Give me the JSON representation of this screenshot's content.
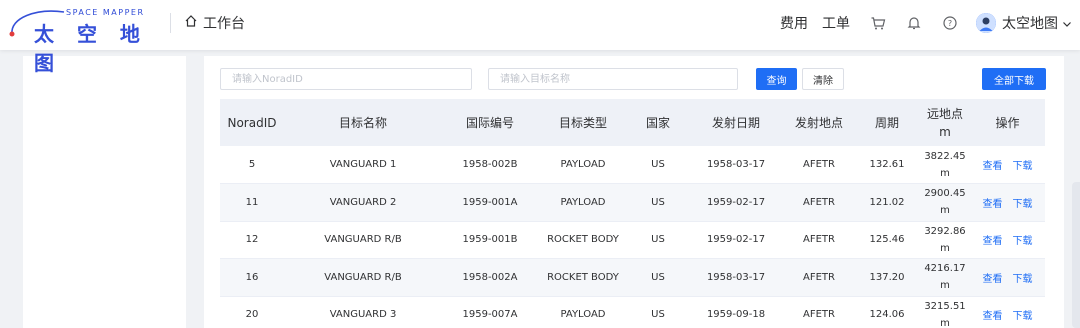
{
  "header": {
    "logo_sub": "SPACE MAPPER",
    "logo_main": "太 空 地 图",
    "workspace_label": "工作台",
    "links": [
      "费用",
      "工单"
    ],
    "user_name": "太空地图"
  },
  "search": {
    "norad_placeholder": "请输入NoradID",
    "name_placeholder": "请输入目标名称",
    "query_label": "查询",
    "clear_label": "清除",
    "download_all_label": "全部下载"
  },
  "table": {
    "columns": [
      "NoradID",
      "目标名称",
      "国际编号",
      "目标类型",
      "国家",
      "发射日期",
      "发射地点",
      "周期",
      "远地点\nm",
      "操作"
    ],
    "col_apogee_line1": "远地点",
    "col_apogee_line2": "m",
    "rows": [
      {
        "norad": "5",
        "name": "VANGUARD 1",
        "intl": "1958-002B",
        "type": "PAYLOAD",
        "country": "US",
        "date": "1958-03-17",
        "site": "AFETR",
        "period": "132.61",
        "apogee": "3822.45",
        "apogee_unit": "m"
      },
      {
        "norad": "11",
        "name": "VANGUARD 2",
        "intl": "1959-001A",
        "type": "PAYLOAD",
        "country": "US",
        "date": "1959-02-17",
        "site": "AFETR",
        "period": "121.02",
        "apogee": "2900.45",
        "apogee_unit": "m"
      },
      {
        "norad": "12",
        "name": "VANGUARD R/B",
        "intl": "1959-001B",
        "type": "ROCKET BODY",
        "country": "US",
        "date": "1959-02-17",
        "site": "AFETR",
        "period": "125.46",
        "apogee": "3292.86",
        "apogee_unit": "m"
      },
      {
        "norad": "16",
        "name": "VANGUARD R/B",
        "intl": "1958-002A",
        "type": "ROCKET BODY",
        "country": "US",
        "date": "1958-03-17",
        "site": "AFETR",
        "period": "137.20",
        "apogee": "4216.17",
        "apogee_unit": "m"
      },
      {
        "norad": "20",
        "name": "VANGUARD 3",
        "intl": "1959-007A",
        "type": "PAYLOAD",
        "country": "US",
        "date": "1959-09-18",
        "site": "AFETR",
        "period": "124.06",
        "apogee": "3215.51",
        "apogee_unit": "m"
      }
    ],
    "view_label": "查看",
    "download_label": "下载"
  },
  "colors": {
    "primary": "#1f6ef5",
    "brand": "#3550d8",
    "header_bg": "#ffffff",
    "page_bg": "#f0f2f5",
    "table_head_bg": "#eef1f7",
    "stripe_bg": "#f5f7fa"
  },
  "icons": [
    "home-icon",
    "cart-icon",
    "bell-icon",
    "help-icon",
    "avatar",
    "chevron-down-icon"
  ]
}
